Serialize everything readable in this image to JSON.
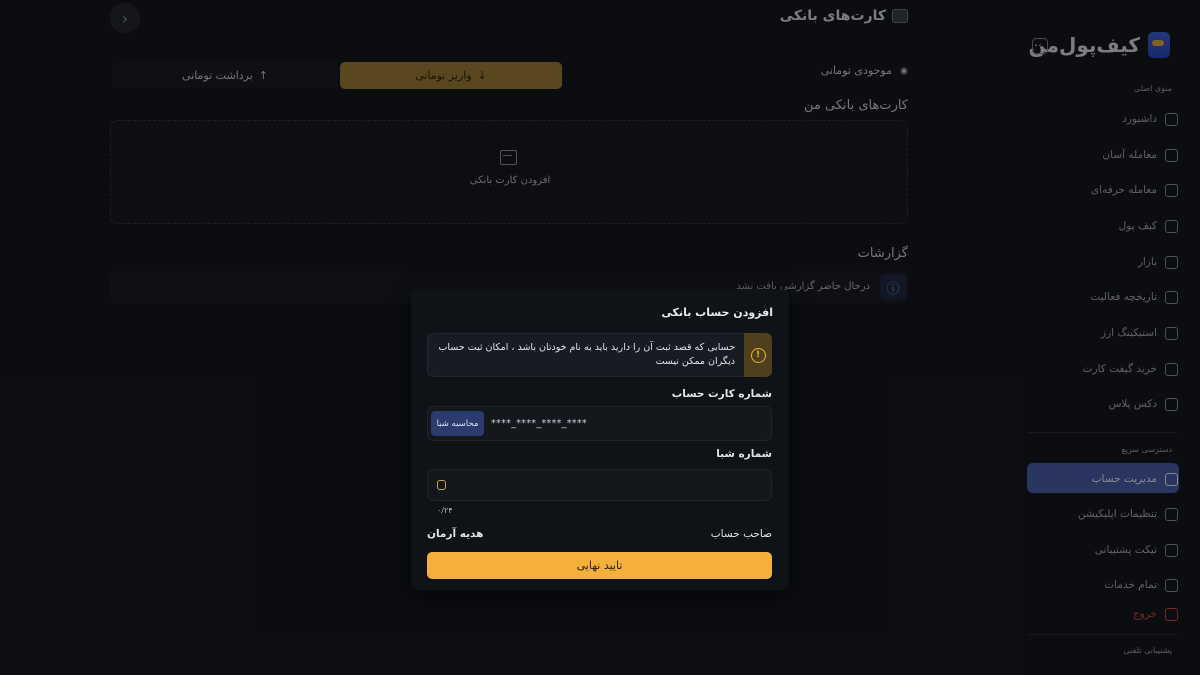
{
  "page": {
    "title": "کارت‌های بانکی",
    "balance_label": "موجودی تومانی",
    "withdraw_label": "برداشت تومانی",
    "deposit_label": "واریز تومانی",
    "my_cards_title": "کارت‌های بانکی من",
    "add_card_label": "افزودن کارت بانکی",
    "reports_title": "گزارشات",
    "reports_empty": "درحال حاضر گزارشی یافت نشد"
  },
  "sidebar": {
    "logo_text": "کیف‌پول‌من",
    "main_menu_heading": "منوی اصلی",
    "main_items": [
      {
        "label": "داشبورد",
        "icon": "dashboard-icon"
      },
      {
        "label": "معامله آسان",
        "icon": "easy-trade-icon"
      },
      {
        "label": "معامله حرفه‌ای",
        "icon": "pro-trade-icon"
      },
      {
        "label": "کیف پول",
        "icon": "wallet-icon"
      },
      {
        "label": "بازار",
        "icon": "market-icon"
      },
      {
        "label": "تاریخچه فعالیت",
        "icon": "history-icon"
      },
      {
        "label": "استیکینگ ارز",
        "icon": "staking-icon"
      },
      {
        "label": "خرید گیفت کارت",
        "icon": "gift-card-icon"
      },
      {
        "label": "دکس پلاس",
        "icon": "dex-icon"
      }
    ],
    "quick_heading": "دسترسی سریع",
    "quick_items": [
      {
        "label": "مدیریت حساب",
        "icon": "account-icon",
        "active": true
      },
      {
        "label": "تنظیمات اپلیکیشن",
        "icon": "settings-icon"
      },
      {
        "label": "تیکت پشتیبانی",
        "icon": "ticket-icon"
      },
      {
        "label": "تمام خدمات",
        "icon": "services-icon"
      }
    ],
    "logout_label": "خروج",
    "phone_support_heading": "پشتیبانی تلفنی"
  },
  "modal": {
    "title": "افزودن حساب بانکی",
    "warning_text": "حسابی که قصد ثبت آن را دارید باید به نام خودتان باشد ، امکان ثبت حساب دیگران ممکن نیست",
    "card_number_label": "شماره کارت حساب",
    "card_number_value": "****_****_****_****",
    "calc_sheba_button": "محاسبه شبا",
    "sheba_label": "شماره شبا",
    "sheba_counter": "۰/۲۴",
    "owner_label": "صاحب حساب",
    "owner_value": "هدیه آرمان",
    "confirm_button": "تایید نهایی"
  },
  "colors": {
    "accent_gold": "#f4b03a",
    "active_nav": "#4a5ca8",
    "warning": "#f0b23a",
    "logout": "#c9483e"
  }
}
